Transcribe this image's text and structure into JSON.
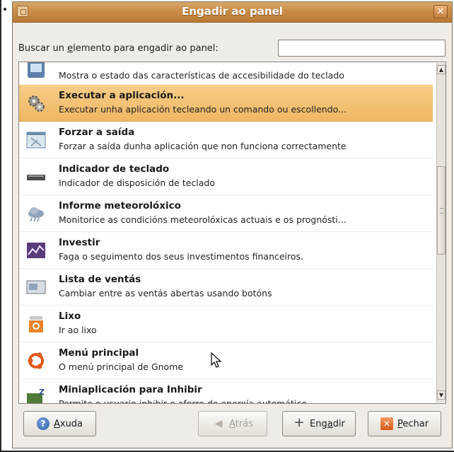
{
  "window": {
    "title": "Engadir ao panel",
    "close_glyph": "✕"
  },
  "search": {
    "label_pre": "Buscar un ",
    "label_accel": "e",
    "label_post": "lemento para engadir ao panel:",
    "value": "",
    "placeholder": ""
  },
  "items": [
    {
      "name": "",
      "desc": "Mostra o estado das características de accesibilidade do teclado",
      "icon": "accessibility-keyboard-icon",
      "selected": false
    },
    {
      "name": "Executar a aplicación...",
      "desc": "Executar unha aplicación tecleando un comando ou escollendo...",
      "icon": "run-application-gears-icon",
      "selected": true
    },
    {
      "name": "Forzar a saída",
      "desc": "Forzar a saída dunha aplicación que non funciona correctamente",
      "icon": "force-quit-icon",
      "selected": false
    },
    {
      "name": "Indicador de teclado",
      "desc": "Indicador de disposición de teclado",
      "icon": "keyboard-icon",
      "selected": false
    },
    {
      "name": "Informe meteorolóxico",
      "desc": "Monitorice as condicións meteorolóxicas actuais e os prognósti...",
      "icon": "weather-cloud-icon",
      "selected": false
    },
    {
      "name": "Investir",
      "desc": "Faga o seguimento dos seus investimentos financeiros.",
      "icon": "stock-chart-icon",
      "selected": false
    },
    {
      "name": "Lista de ventás",
      "desc": "Cambiar entre as ventás abertas usando botóns",
      "icon": "window-list-icon",
      "selected": false
    },
    {
      "name": "Lixo",
      "desc": "Ir ao lixo",
      "icon": "trash-icon",
      "selected": false
    },
    {
      "name": "Menú principal",
      "desc": "O menú principal de Gnome",
      "icon": "ubuntu-logo-icon",
      "selected": false
    },
    {
      "name": "Miniaplicación para Inhibir",
      "desc": "Permite o usuario inhibir o aforro de enerxía automático",
      "icon": "inhibit-applet-icon",
      "selected": false
    }
  ],
  "buttons": {
    "help": {
      "pre": "",
      "accel": "A",
      "post": "xuda"
    },
    "back": {
      "pre": "",
      "accel": "A",
      "post": "trás"
    },
    "add": {
      "pre": "Eng",
      "accel": "a",
      "post": "dir"
    },
    "close": {
      "pre": "",
      "accel": "P",
      "post": "echar"
    }
  },
  "colors": {
    "titlebar": "#c88a45",
    "selection": "#efb762",
    "window_bg": "#efebe7"
  }
}
